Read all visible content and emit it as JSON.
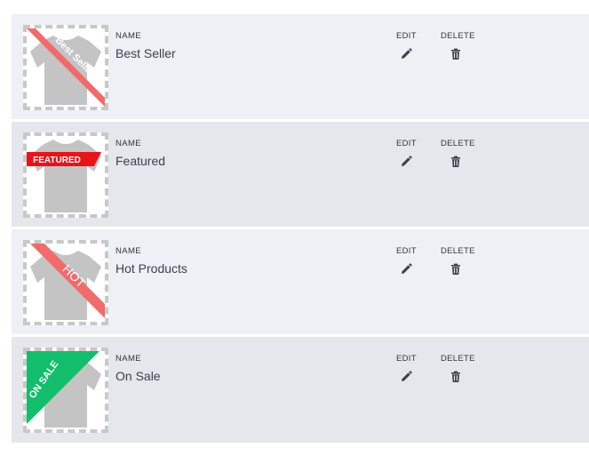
{
  "columns": {
    "name_label": "NAME",
    "edit_label": "EDIT",
    "delete_label": "DELETE"
  },
  "badges": [
    {
      "name": "Best Seller",
      "ribbon_text": "Best Seller",
      "ribbon_color": "#f16b6b",
      "ribbon_style": "diagonal-corner"
    },
    {
      "name": "Featured",
      "ribbon_text": "FEATURED",
      "ribbon_color": "#e8141b",
      "ribbon_style": "horizontal-banner"
    },
    {
      "name": "Hot Products",
      "ribbon_text": "HOT",
      "ribbon_color": "#f16b6b",
      "ribbon_style": "diagonal-corner"
    },
    {
      "name": "On Sale",
      "ribbon_text": "ON SALE",
      "ribbon_color": "#12bd6b",
      "ribbon_style": "corner-triangle"
    }
  ],
  "icons": {
    "edit": "pencil-icon",
    "delete": "trash-icon",
    "product": "tshirt-icon"
  },
  "colors": {
    "row_bg": "#eff0f5",
    "row_alt_bg": "#e6e7ec",
    "tshirt": "#c4c4c4",
    "icon": "#3d3f4a"
  }
}
